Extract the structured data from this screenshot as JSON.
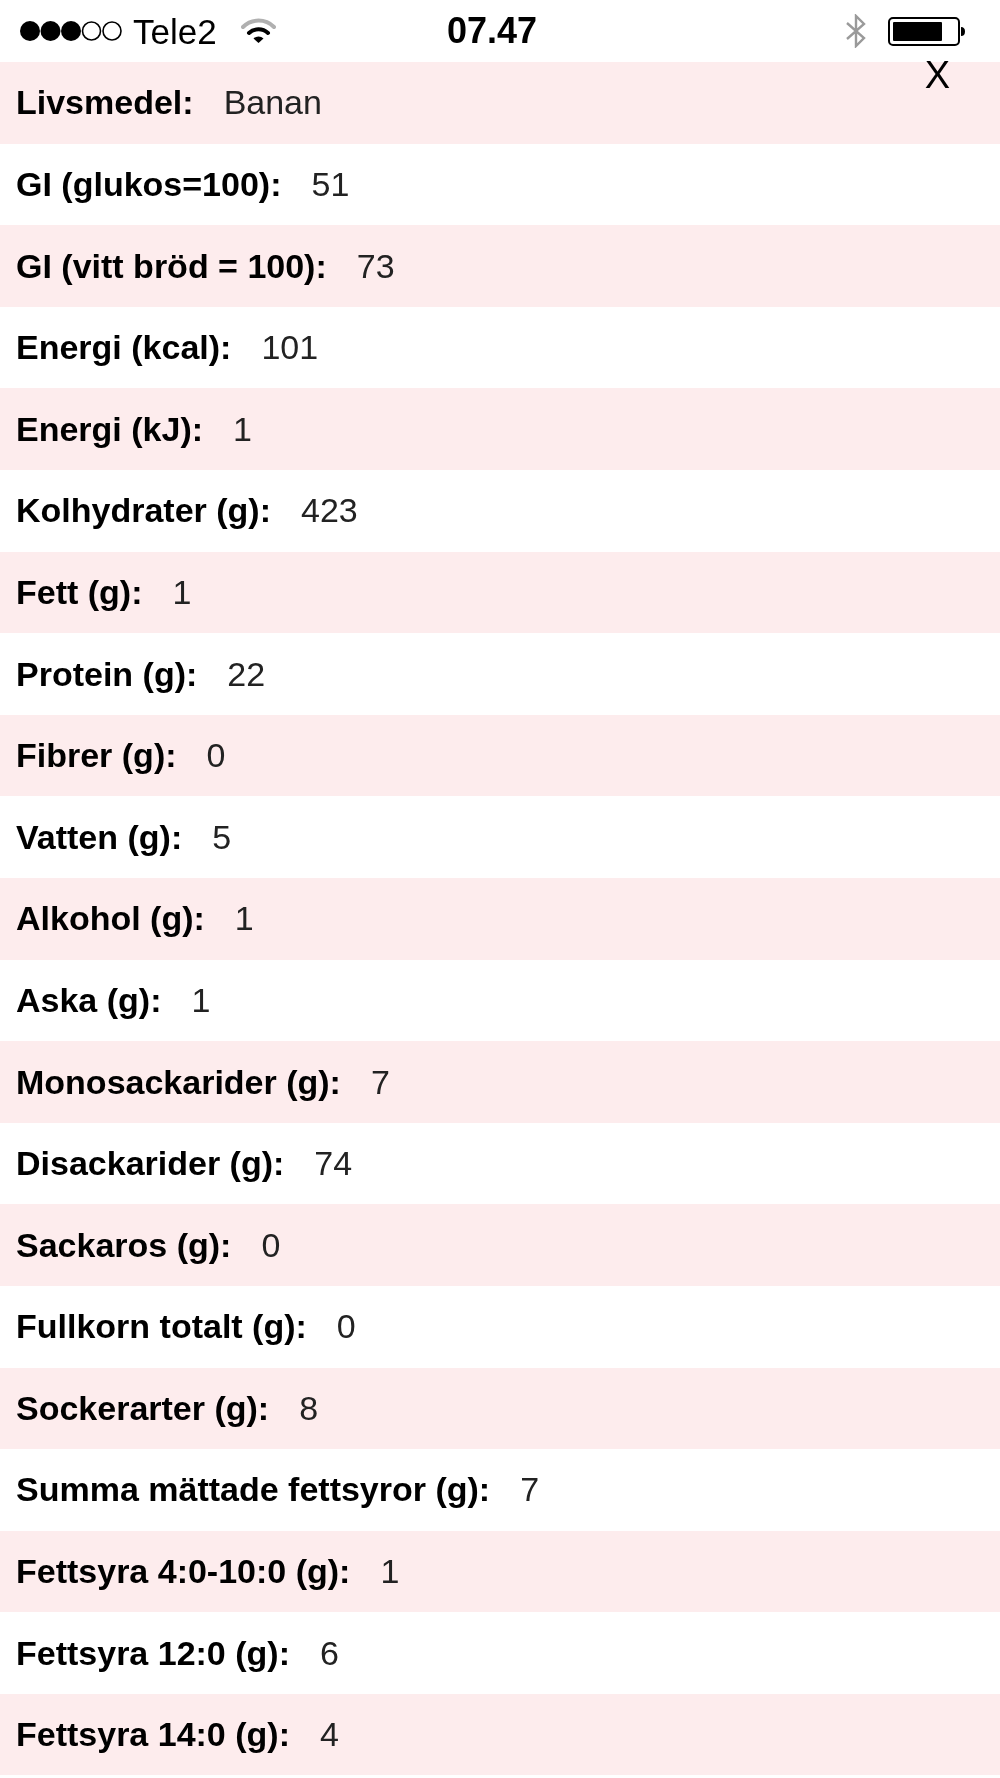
{
  "status_bar": {
    "carrier": "Tele2",
    "time": "07.47"
  },
  "close_button": {
    "label": "X"
  },
  "rows": [
    {
      "label": "Livsmedel:",
      "value": "Banan"
    },
    {
      "label": "GI (glukos=100):",
      "value": "51"
    },
    {
      "label": "GI (vitt bröd = 100):",
      "value": "73"
    },
    {
      "label": "Energi (kcal):",
      "value": "101"
    },
    {
      "label": "Energi (kJ):",
      "value": "1"
    },
    {
      "label": "Kolhydrater (g):",
      "value": "423"
    },
    {
      "label": "Fett (g):",
      "value": "1"
    },
    {
      "label": "Protein (g):",
      "value": "22"
    },
    {
      "label": "Fibrer (g):",
      "value": "0"
    },
    {
      "label": "Vatten (g):",
      "value": "5"
    },
    {
      "label": "Alkohol (g):",
      "value": "1"
    },
    {
      "label": "Aska (g):",
      "value": "1"
    },
    {
      "label": "Monosackarider (g):",
      "value": "7"
    },
    {
      "label": "Disackarider (g):",
      "value": "74"
    },
    {
      "label": "Sackaros (g):",
      "value": "0"
    },
    {
      "label": "Fullkorn totalt (g):",
      "value": "0"
    },
    {
      "label": "Sockerarter (g):",
      "value": "8"
    },
    {
      "label": "Summa mättade fettsyror (g):",
      "value": "7"
    },
    {
      "label": "Fettsyra 4:0-10:0 (g):",
      "value": "1"
    },
    {
      "label": "Fettsyra 12:0 (g):",
      "value": "6"
    },
    {
      "label": "Fettsyra 14:0 (g):",
      "value": "4"
    }
  ]
}
